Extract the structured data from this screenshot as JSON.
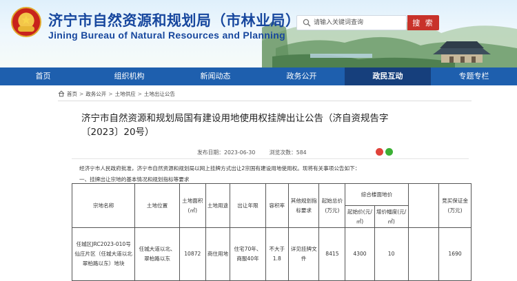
{
  "header": {
    "title": "济宁市自然资源和规划局（市林业局）",
    "subtitle": "Jining Bureau of Natural Resources and Planning",
    "search_placeholder": "请输入关键词查询",
    "search_button": "搜 索"
  },
  "nav": {
    "items": [
      {
        "label": "首页"
      },
      {
        "label": "组织机构"
      },
      {
        "label": "新闻动态"
      },
      {
        "label": "政务公开"
      },
      {
        "label": "政民互动"
      },
      {
        "label": "专题专栏"
      }
    ]
  },
  "breadcrumb": {
    "items": [
      "首页",
      "政务公开",
      "土地供应",
      "土地出让公告"
    ],
    "separator": ">"
  },
  "article": {
    "title": "济宁市自然资源和规划局国有建设用地使用权挂牌出让公告（济自资规告字〔2023〕20号）",
    "publish_label": "发布日期：2023-06-30",
    "views_label": "浏览次数：584",
    "para1": "经济宁市人民政府批准，济宁市自然资源和规划局以网上挂牌方式出让2宗国有建设用地使用权。现将有关事项公告如下：",
    "para2": "一、挂牌出让宗地的基本情况和规划指标等要求"
  },
  "table": {
    "headers": {
      "parcel_name": "宗地名称",
      "location": "土地位置",
      "area": "土地面积(㎡)",
      "use": "土地用途",
      "term": "出让年限",
      "far": "容积率",
      "other": "其他规划指标要求",
      "start_total": "起始总价(万元)",
      "unit_price_group": "综合楼面地价",
      "start_unit": "起始价(元/㎡)",
      "increment": "增价幅度(元/㎡)",
      "deposit": "竞买保证金(万元)"
    },
    "rows": [
      {
        "parcel_name": "任城区JRC2023-010号仙庄片区（任城大道以北翠柏路以东）地块",
        "location": "任城大道以北、翠柏路以东",
        "area": "10872",
        "use": "商住用地",
        "term": "住宅70年、商服40年",
        "far": "不大于1.8",
        "other": "详见挂牌文件",
        "start_total": "8415",
        "start_unit": "4300",
        "increment": "10",
        "deposit": "1690"
      }
    ]
  },
  "colors": {
    "title_blue": "#17479e",
    "nav_blue": "#1e5fae",
    "nav_active": "#163f7c",
    "search_red": "#c8322a"
  }
}
